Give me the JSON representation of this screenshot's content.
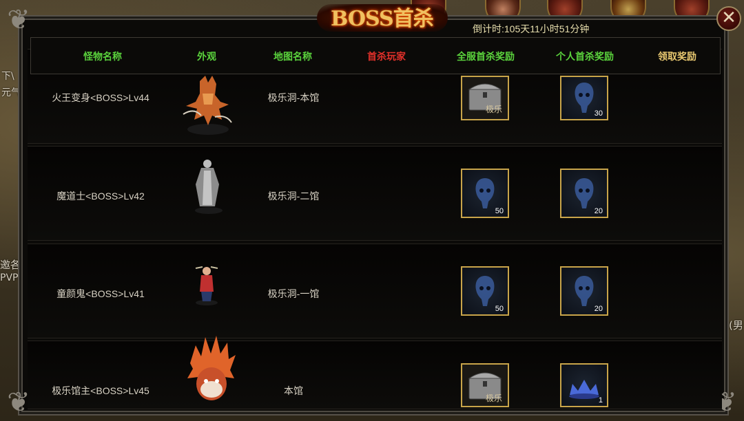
{
  "title": "BOSS首杀",
  "countdown": "倒计时:105天11小时51分钟",
  "close_label": "✕",
  "headers": {
    "monster_name": "怪物名称",
    "appearance": "外观",
    "map_name": "地图名称",
    "first_kill_player": "首杀玩家",
    "server_reward": "全服首杀奖励",
    "personal_reward": "个人首杀奖励",
    "claim_reward": "领取奖励"
  },
  "header_colors": {
    "green": "#5ad23c",
    "red": "#e0302a",
    "gold": "#e8c870"
  },
  "rows": [
    {
      "name": "火王变身<BOSS>Lv44",
      "map": "极乐洞-本馆",
      "server_reward": {
        "icon": "chest-icon",
        "label": "极乐",
        "count": ""
      },
      "personal_reward": {
        "icon": "skull-gem-icon",
        "count": "30"
      }
    },
    {
      "name": "魔道士<BOSS>Lv42",
      "map": "极乐洞-二馆",
      "server_reward": {
        "icon": "skull-gem-icon",
        "count": "50"
      },
      "personal_reward": {
        "icon": "skull-gem-icon",
        "count": "20"
      }
    },
    {
      "name": "童颜鬼<BOSS>Lv41",
      "map": "极乐洞-一馆",
      "server_reward": {
        "icon": "skull-gem-icon",
        "count": "50"
      },
      "personal_reward": {
        "icon": "skull-gem-icon",
        "count": "20"
      }
    },
    {
      "name": "极乐馆主<BOSS>Lv45",
      "map": "本馆",
      "server_reward": {
        "icon": "chest-icon",
        "label": "极乐",
        "count": ""
      },
      "personal_reward": {
        "icon": "crown-gem-icon",
        "count": "1"
      }
    }
  ],
  "background_text": {
    "left1": "下\\",
    "left2": "元气",
    "left3": "邀各",
    "left4": "PVP",
    "right1": "(男"
  }
}
